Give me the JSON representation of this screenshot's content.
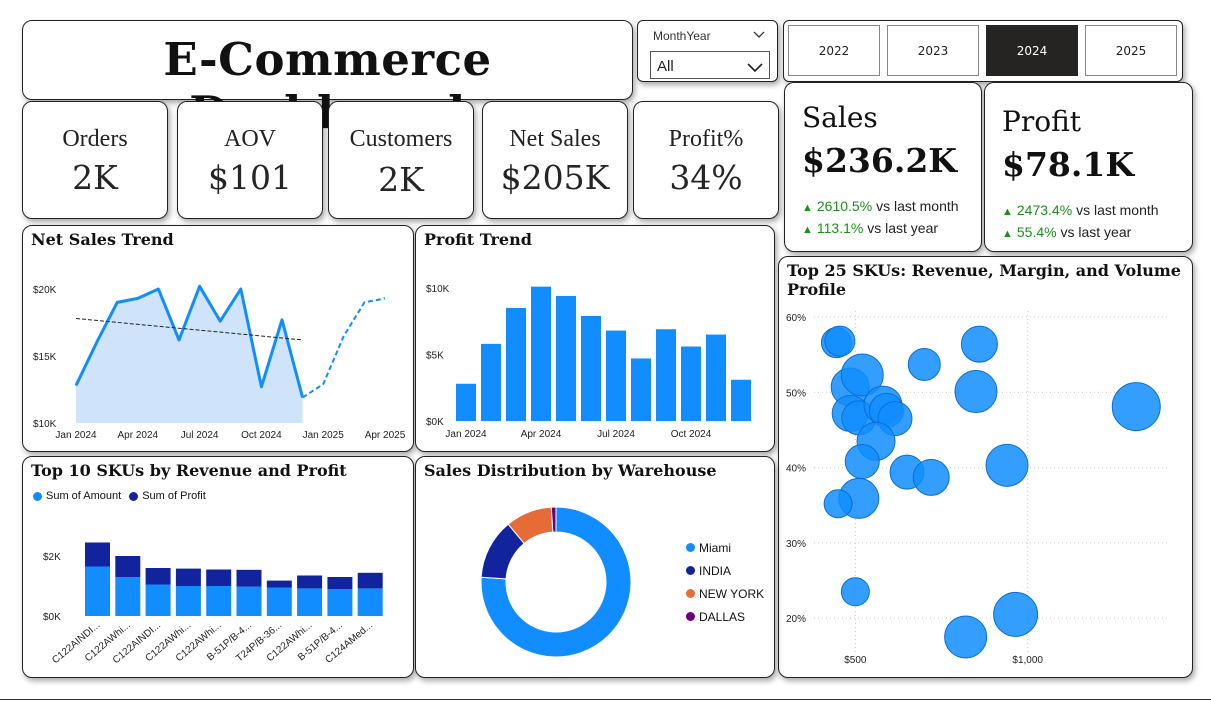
{
  "title": "E-Commerce Dashboard",
  "slicer": {
    "label": "MonthYear",
    "value": "All"
  },
  "years": [
    {
      "label": "2022",
      "selected": false
    },
    {
      "label": "2023",
      "selected": false
    },
    {
      "label": "2024",
      "selected": true
    },
    {
      "label": "2025",
      "selected": false
    }
  ],
  "kpis": [
    {
      "label": "Orders",
      "value": "2K"
    },
    {
      "label": "AOV",
      "value": "$101"
    },
    {
      "label": "Customers",
      "value": "2K"
    },
    {
      "label": "Net Sales",
      "value": "$205K"
    },
    {
      "label": "Profit%",
      "value": "34%"
    }
  ],
  "sales_card": {
    "label": "Sales",
    "value": "$236.2K",
    "delta1_pct": "2610.5%",
    "delta1_text": "vs last month",
    "delta2_pct": "113.1%",
    "delta2_text": "vs last year"
  },
  "profit_card": {
    "label": "Profit",
    "value": "$78.1K",
    "delta1_pct": "2473.4%",
    "delta1_text": "vs last month",
    "delta2_pct": "55.4%",
    "delta2_text": "vs last year"
  },
  "colors": {
    "blue": "#118DFF",
    "navy": "#12239E",
    "orange": "#E66C37",
    "purple": "#6B007B",
    "area": "#cfe4fa",
    "green": "#1a8f1a"
  },
  "chart_data": [
    {
      "id": "net_sales_trend",
      "type": "line",
      "title": "Net Sales Trend",
      "x_ticks": [
        "Jan 2024",
        "Apr 2024",
        "Jul 2024",
        "Oct 2024",
        "Jan 2025",
        "Apr 2025"
      ],
      "y_ticks": [
        "$10K",
        "$15K",
        "$20K"
      ],
      "ylim": [
        10000,
        20000
      ],
      "months": [
        "2024-01",
        "2024-02",
        "2024-03",
        "2024-04",
        "2024-05",
        "2024-06",
        "2024-07",
        "2024-08",
        "2024-09",
        "2024-10",
        "2024-11",
        "2024-12"
      ],
      "values": [
        12800,
        16000,
        19000,
        19300,
        20000,
        16200,
        20200,
        17600,
        20000,
        12700,
        17700,
        11900
      ],
      "forecast_months": [
        "2024-12",
        "2025-01",
        "2025-02",
        "2025-03",
        "2025-04"
      ],
      "forecast_values": [
        11900,
        12900,
        16500,
        19000,
        19300
      ],
      "trend_start": 17800,
      "trend_end": 16200
    },
    {
      "id": "profit_trend",
      "type": "bar",
      "title": "Profit Trend",
      "x_ticks": [
        "Jan 2024",
        "Apr 2024",
        "Jul 2024",
        "Oct 2024"
      ],
      "y_ticks": [
        "$0K",
        "$5K",
        "$10K"
      ],
      "ylim": [
        0,
        10000
      ],
      "categories": [
        "Jan 2024",
        "Feb 2024",
        "Mar 2024",
        "Apr 2024",
        "May 2024",
        "Jun 2024",
        "Jul 2024",
        "Aug 2024",
        "Sep 2024",
        "Oct 2024",
        "Nov 2024",
        "Dec 2024"
      ],
      "values": [
        2800,
        5800,
        8500,
        10100,
        9400,
        7900,
        6800,
        4700,
        6900,
        5600,
        6500,
        3100
      ]
    },
    {
      "id": "top10_skus",
      "type": "bar",
      "title": "Top 10 SKUs by Revenue and Profit",
      "stacked": true,
      "y_ticks": [
        "$0K",
        "$2K"
      ],
      "ylim": [
        0,
        2700
      ],
      "categories": [
        "C122AINDI...",
        "C122AWhi...",
        "C122AINDI...",
        "C122AWhi...",
        "C122AWhi...",
        "B-51P/B-4...",
        "T24P/B-36...",
        "C122AWhi...",
        "B-51P/B-4...",
        "C124AMed..."
      ],
      "series": [
        {
          "name": "Sum of Amount",
          "values": [
            1650,
            1300,
            1050,
            1000,
            1000,
            980,
            950,
            920,
            900,
            920
          ]
        },
        {
          "name": "Sum of Profit",
          "values": [
            800,
            700,
            550,
            580,
            550,
            560,
            230,
            430,
            400,
            520
          ]
        }
      ]
    },
    {
      "id": "warehouse",
      "type": "pie",
      "title": "Sales Distribution by Warehouse",
      "labels": [
        "Miami",
        "INDIA",
        "NEW YORK",
        "DALLAS"
      ],
      "values": [
        76,
        13,
        10,
        1
      ]
    },
    {
      "id": "top25_skus",
      "type": "scatter",
      "title": "Top 25 SKUs: Revenue, Margin, and Volume Profile",
      "x_ticks": [
        "$500",
        "$1,000"
      ],
      "y_ticks": [
        "20%",
        "30%",
        "40%",
        "50%",
        "60%"
      ],
      "xlim": [
        380,
        1410
      ],
      "ylim": [
        15.5,
        60.8
      ],
      "points": [
        {
          "x": 445,
          "y": 56.6,
          "s": 15
        },
        {
          "x": 455,
          "y": 56.8,
          "s": 15
        },
        {
          "x": 485,
          "y": 50.7,
          "s": 19
        },
        {
          "x": 520,
          "y": 52.3,
          "s": 21
        },
        {
          "x": 485,
          "y": 47.2,
          "s": 18
        },
        {
          "x": 510,
          "y": 46.6,
          "s": 17
        },
        {
          "x": 580,
          "y": 48.3,
          "s": 19
        },
        {
          "x": 590,
          "y": 47.6,
          "s": 17
        },
        {
          "x": 615,
          "y": 46.5,
          "s": 17
        },
        {
          "x": 560,
          "y": 43.5,
          "s": 19
        },
        {
          "x": 520,
          "y": 40.8,
          "s": 17
        },
        {
          "x": 650,
          "y": 39.4,
          "s": 17
        },
        {
          "x": 720,
          "y": 38.7,
          "s": 18
        },
        {
          "x": 510,
          "y": 35.9,
          "s": 20
        },
        {
          "x": 450,
          "y": 35.2,
          "s": 14
        },
        {
          "x": 700,
          "y": 53.7,
          "s": 16
        },
        {
          "x": 860,
          "y": 56.4,
          "s": 18
        },
        {
          "x": 850,
          "y": 50.1,
          "s": 21
        },
        {
          "x": 940,
          "y": 40.3,
          "s": 21
        },
        {
          "x": 1315,
          "y": 48.1,
          "s": 24
        },
        {
          "x": 500,
          "y": 23.5,
          "s": 14
        },
        {
          "x": 820,
          "y": 17.5,
          "s": 21
        },
        {
          "x": 965,
          "y": 20.5,
          "s": 22
        }
      ]
    }
  ]
}
